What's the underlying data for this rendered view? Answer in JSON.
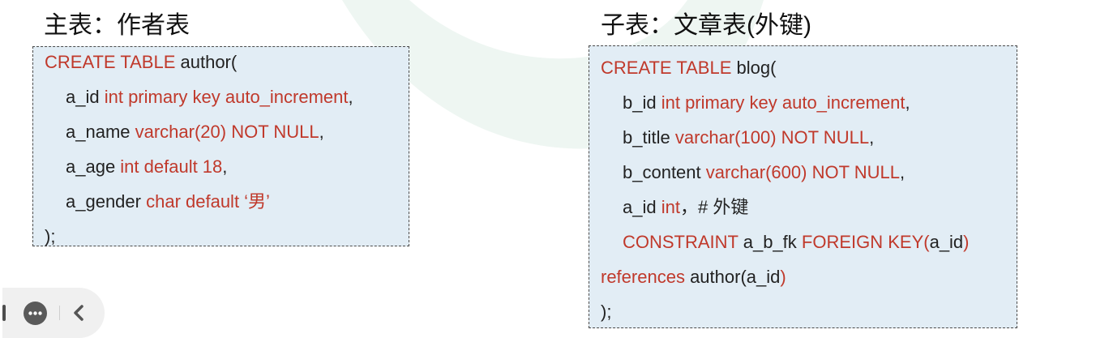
{
  "left_panel": {
    "heading": "主表：作者表",
    "lines": [
      [
        {
          "text": "CREATE TABLE ",
          "kind": "kw"
        },
        {
          "text": "author(",
          "kind": "tx"
        }
      ],
      [
        {
          "text": "a_id  ",
          "kind": "tx"
        },
        {
          "text": "int primary key auto_increment",
          "kind": "kw"
        },
        {
          "text": ",",
          "kind": "tx"
        }
      ],
      [
        {
          "text": "a_name  ",
          "kind": "tx"
        },
        {
          "text": "varchar(20) NOT NULL",
          "kind": "kw"
        },
        {
          "text": ",",
          "kind": "tx"
        }
      ],
      [
        {
          "text": "a_age  ",
          "kind": "tx"
        },
        {
          "text": "int default 18",
          "kind": "kw"
        },
        {
          "text": ",",
          "kind": "tx"
        }
      ],
      [
        {
          "text": "a_gender  ",
          "kind": "tx"
        },
        {
          "text": "char default ‘男’",
          "kind": "kw"
        }
      ],
      [
        {
          "text": ");",
          "kind": "tx"
        }
      ]
    ]
  },
  "right_panel": {
    "heading": "子表：文章表(外键)",
    "lines": [
      [
        {
          "text": "CREATE TABLE ",
          "kind": "kw"
        },
        {
          "text": "blog(",
          "kind": "tx"
        }
      ],
      [
        {
          "text": "b_id  ",
          "kind": "tx"
        },
        {
          "text": "int primary key auto_increment",
          "kind": "kw"
        },
        {
          "text": ",",
          "kind": "tx"
        }
      ],
      [
        {
          "text": "b_title ",
          "kind": "tx"
        },
        {
          "text": "varchar(100) NOT NULL",
          "kind": "kw"
        },
        {
          "text": ",",
          "kind": "tx"
        }
      ],
      [
        {
          "text": "b_content ",
          "kind": "tx"
        },
        {
          "text": "varchar(600) NOT NULL",
          "kind": "kw"
        },
        {
          "text": ",",
          "kind": "tx"
        }
      ],
      [
        {
          "text": "a_id ",
          "kind": "tx"
        },
        {
          "text": "int",
          "kind": "kw"
        },
        {
          "text": "，# 外键",
          "kind": "tx"
        }
      ],
      [
        {
          "text": "CONSTRAINT ",
          "kind": "kw"
        },
        {
          "text": "a_b_fk  ",
          "kind": "tx"
        },
        {
          "text": "FOREIGN KEY(",
          "kind": "kw"
        },
        {
          "text": "a_id",
          "kind": "tx"
        },
        {
          "text": ")",
          "kind": "kw"
        }
      ],
      [
        {
          "text": "references ",
          "kind": "kw"
        },
        {
          "text": "author(",
          "kind": "tx"
        },
        {
          "text": "a_id",
          "kind": "tx"
        },
        {
          "text": ")",
          "kind": "kw"
        }
      ],
      [
        {
          "text": ");",
          "kind": "tx"
        }
      ]
    ]
  },
  "toolbar": {
    "icons": [
      "panel-toggle-icon",
      "more-icon",
      "chevron-left-icon"
    ]
  },
  "colors": {
    "keyword": "#c0392b",
    "text": "#222222",
    "code_background": "#e2edf5",
    "decoration": "#eef6f2"
  }
}
